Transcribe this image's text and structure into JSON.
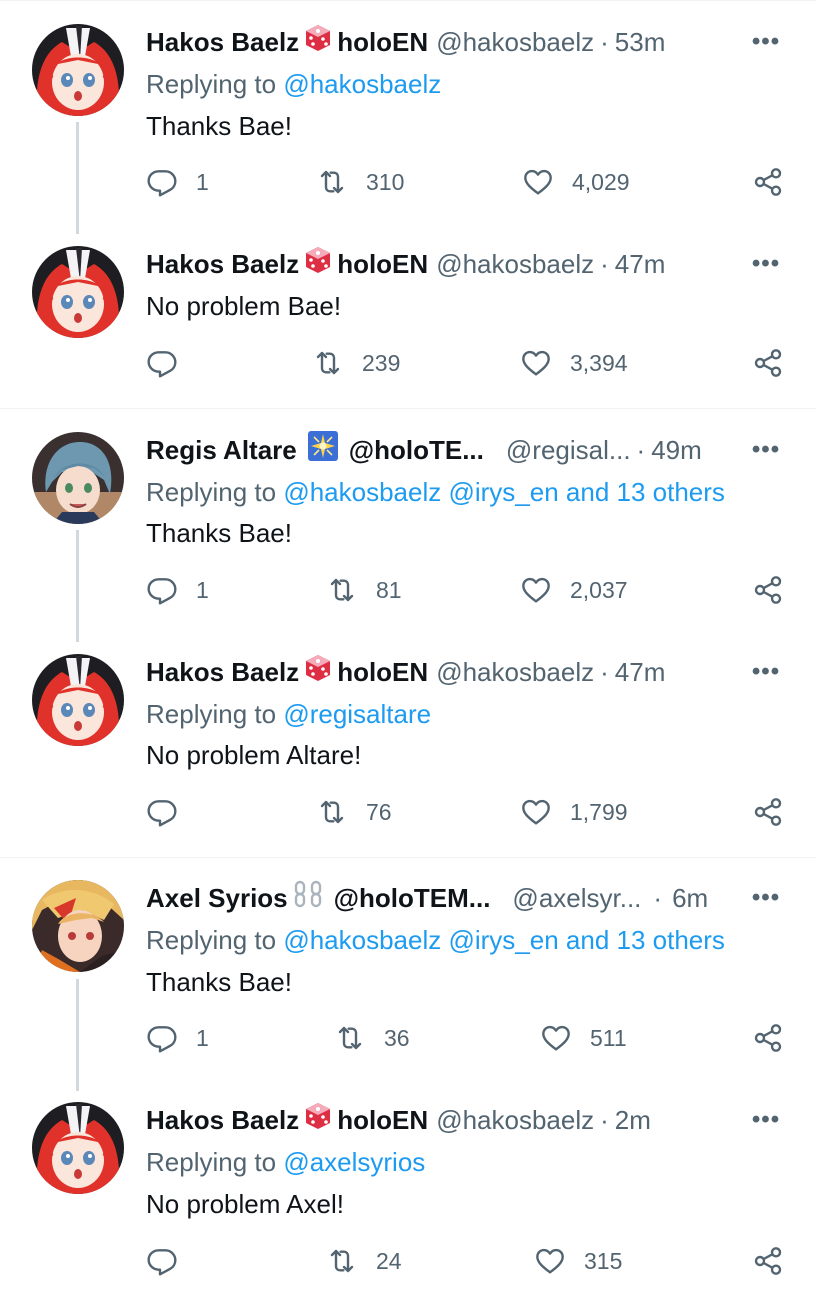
{
  "tweets": [
    {
      "name": "Hakos Baelz",
      "name_suffix": "holoEN",
      "handle": "@hakosbaelz",
      "time": "53m",
      "reply_prefix": "Replying to",
      "reply_to": "@hakosbaelz",
      "text": "Thanks Bae!",
      "replies": "1",
      "retweets": "310",
      "likes": "4,029"
    },
    {
      "name": "Hakos Baelz",
      "name_suffix": "holoEN",
      "handle": "@hakosbaelz",
      "time": "47m",
      "text": "No problem Bae!",
      "replies": "",
      "retweets": "239",
      "likes": "3,394"
    },
    {
      "name": "Regis Altare",
      "name_suffix": "@holoTE...",
      "handle": "@regisal...",
      "time": "49m",
      "reply_prefix": "Replying to",
      "reply_to": "@hakosbaelz @irys_en and 13 others",
      "text": "Thanks Bae!",
      "replies": "1",
      "retweets": "81",
      "likes": "2,037"
    },
    {
      "name": "Hakos Baelz",
      "name_suffix": "holoEN",
      "handle": "@hakosbaelz",
      "time": "47m",
      "reply_prefix": "Replying to",
      "reply_to": "@regisaltare",
      "text": "No problem Altare!",
      "replies": "",
      "retweets": "76",
      "likes": "1,799"
    },
    {
      "name": "Axel Syrios",
      "name_suffix": "@holoTEM...",
      "handle": "@axelsyr...",
      "time": "6m",
      "reply_prefix": "Replying to",
      "reply_to": "@hakosbaelz @irys_en and 13 others",
      "text": "Thanks Bae!",
      "replies": "1",
      "retweets": "36",
      "likes": "511"
    },
    {
      "name": "Hakos Baelz",
      "name_suffix": "holoEN",
      "handle": "@hakosbaelz",
      "time": "2m",
      "reply_prefix": "Replying to",
      "reply_to": "@axelsyrios",
      "text": "No problem Axel!",
      "replies": "",
      "retweets": "24",
      "likes": "315"
    }
  ],
  "colors": {
    "link": "#1d9bf0",
    "secondary_text": "#536471",
    "primary_text": "#0f1419",
    "thread_line": "#cfd9de",
    "separator": "#eff3f4"
  },
  "icons": {
    "more": "more-icon",
    "reply": "reply-icon",
    "retweet": "retweet-icon",
    "like": "heart-icon",
    "share": "share-icon",
    "dice_emoji": "dice-emoji-icon",
    "sparkle_emoji": "sparkle-emoji-icon",
    "chain_emoji": "chain-emoji-icon"
  }
}
